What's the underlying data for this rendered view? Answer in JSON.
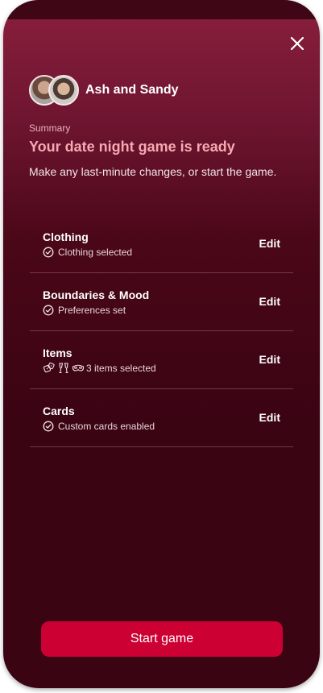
{
  "couple": {
    "name": "Ash and Sandy"
  },
  "summary": {
    "label": "Summary",
    "headline": "Your date night game is ready",
    "description": "Make any last-minute changes, or start the game."
  },
  "sections": [
    {
      "title": "Clothing",
      "status": "Clothing selected",
      "edit_label": "Edit"
    },
    {
      "title": "Boundaries & Mood",
      "status": "Preferences set",
      "edit_label": "Edit"
    },
    {
      "title": "Items",
      "status": "3 items selected",
      "edit_label": "Edit",
      "icons": [
        "dice-icon",
        "glasses-icon",
        "mask-icon"
      ]
    },
    {
      "title": "Cards",
      "status": "Custom cards enabled",
      "edit_label": "Edit"
    }
  ],
  "actions": {
    "start_label": "Start game"
  },
  "colors": {
    "accent": "#cc0033",
    "headline": "#f6a9b3",
    "background_top": "#8a1f3d",
    "background_bottom": "#3a0412"
  }
}
